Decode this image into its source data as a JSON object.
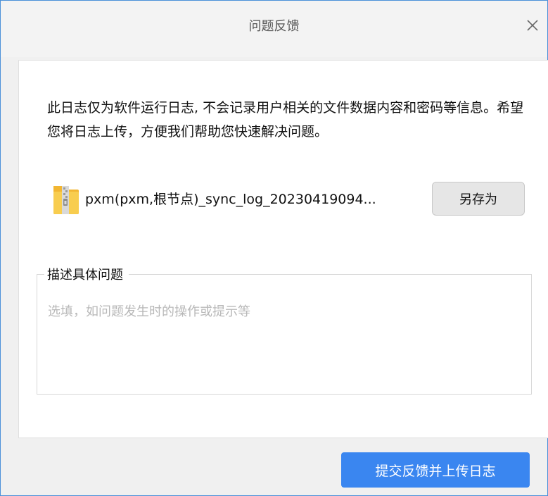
{
  "window": {
    "title": "问题反馈"
  },
  "notice": {
    "text": "此日志仅为软件运行日志, 不会记录用户相关的文件数据内容和密码等信息。希望您将日志上传，方便我们帮助您快速解决问题。"
  },
  "attachment": {
    "file_name": "pxm(pxm,根节点)_sync_log_20230419094...",
    "icon": "zip-file-icon",
    "save_as_label": "另存为"
  },
  "description": {
    "legend": "描述具体问题",
    "value": "",
    "placeholder": "选填，如问题发生时的操作或提示等"
  },
  "footer": {
    "submit_label": "提交反馈并上传日志"
  },
  "colors": {
    "accent": "#3a86f0",
    "window_border": "#4a90d9",
    "placeholder": "#b8b8b8"
  }
}
